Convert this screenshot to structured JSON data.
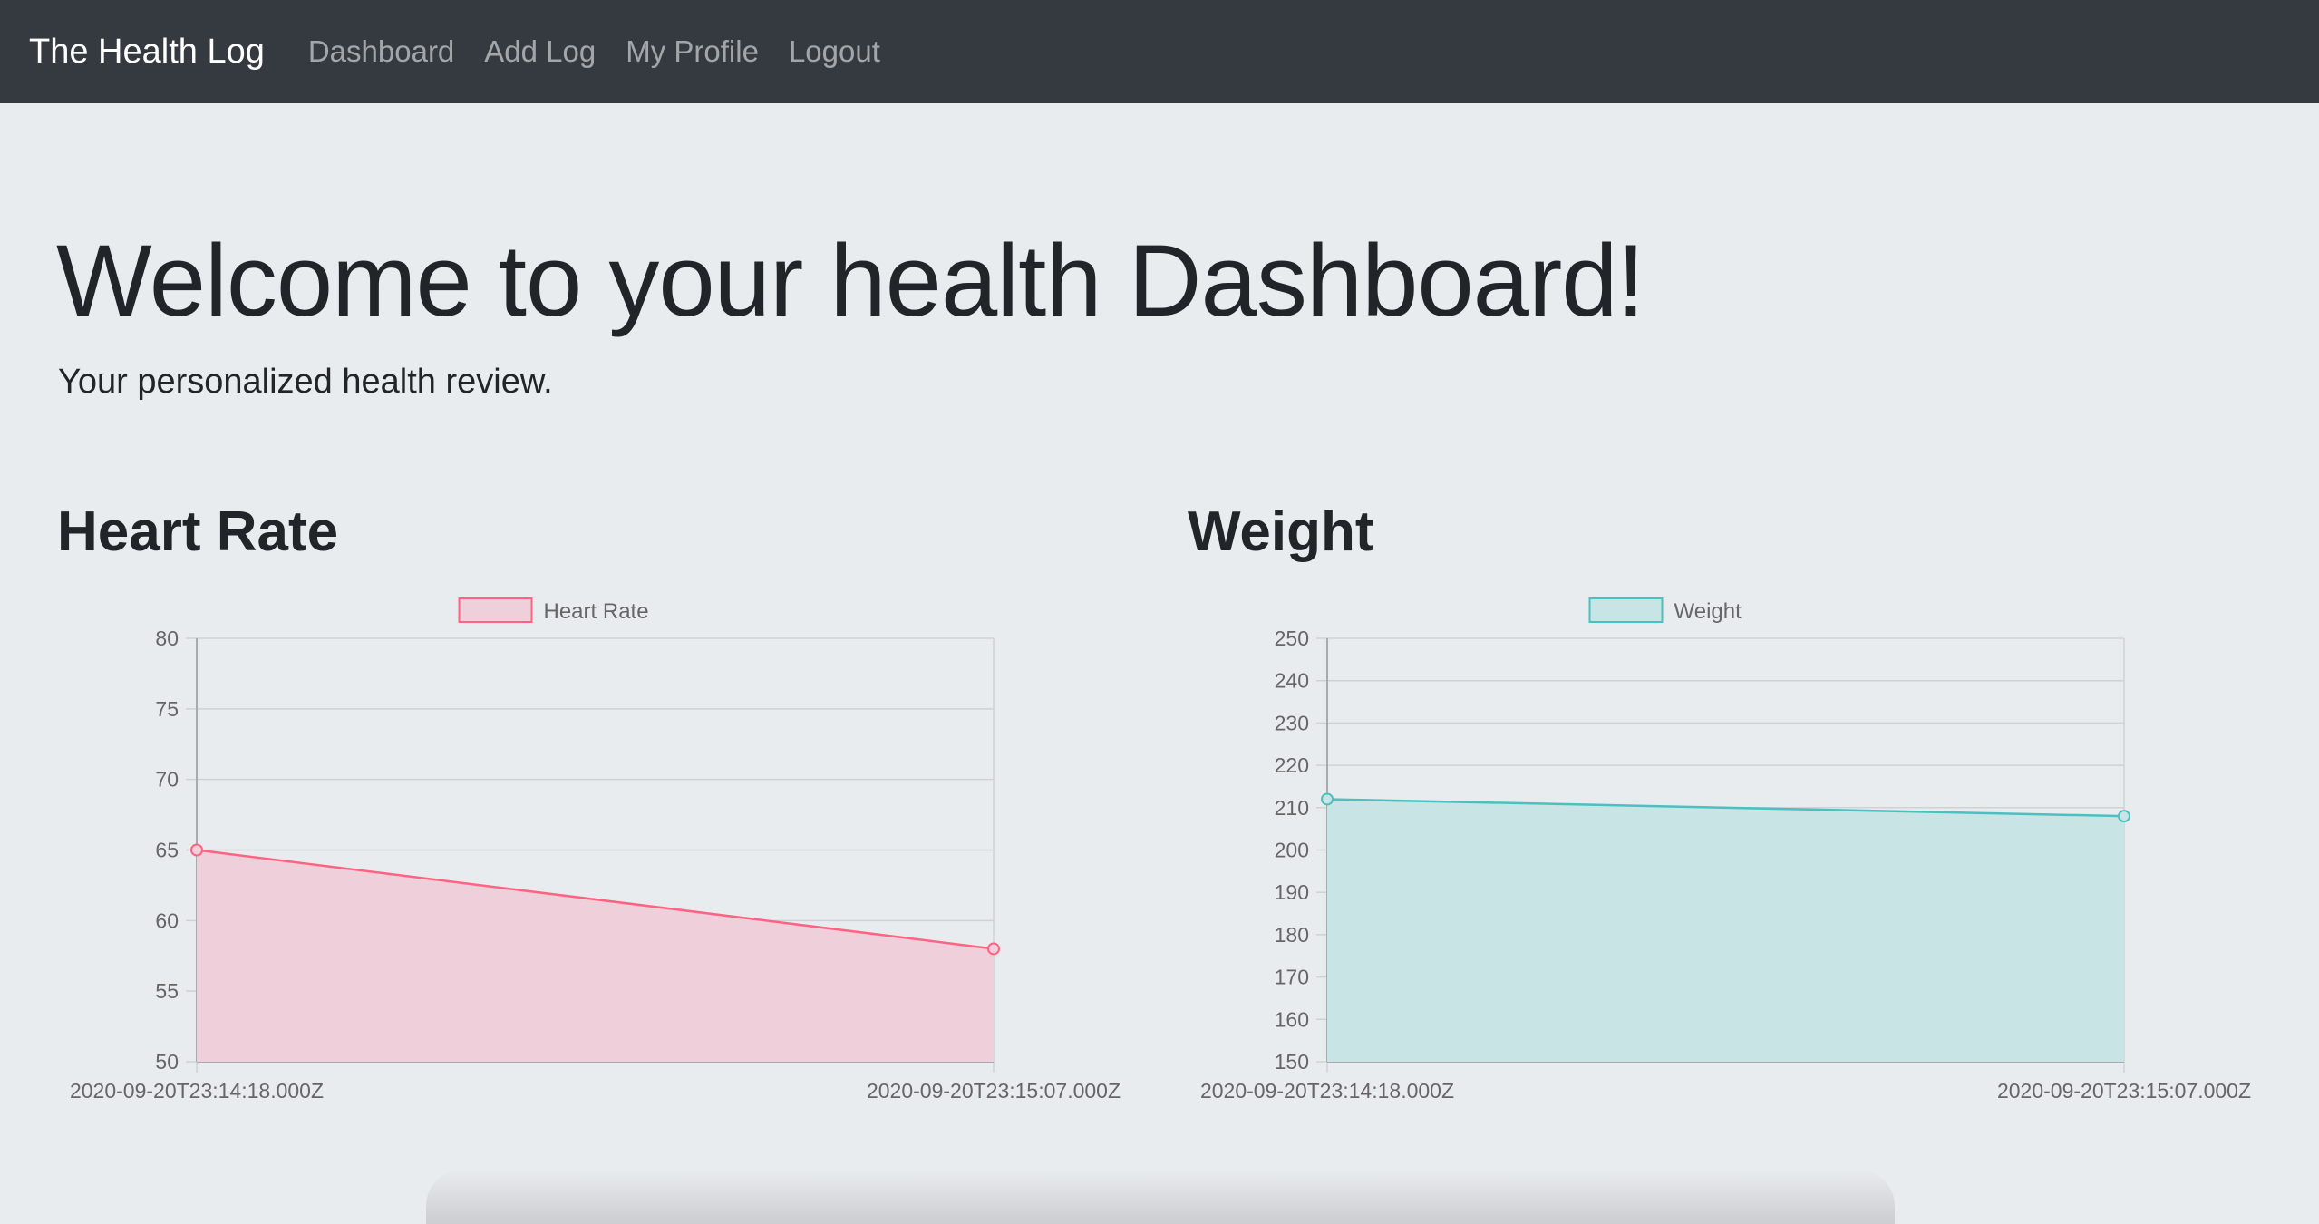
{
  "navbar": {
    "brand": "The Health Log",
    "links": [
      "Dashboard",
      "Add Log",
      "My Profile",
      "Logout"
    ]
  },
  "hero": {
    "title": "Welcome to your health Dashboard!",
    "subtitle": "Your personalized health review."
  },
  "sections": {
    "heart_rate_title": "Heart Rate",
    "weight_title": "Weight"
  },
  "chart_data": [
    {
      "type": "area",
      "title": "Heart Rate",
      "x": [
        "2020-09-20T23:14:18.000Z",
        "2020-09-20T23:15:07.000Z"
      ],
      "series": [
        {
          "name": "Heart Rate",
          "values": [
            65,
            58
          ]
        }
      ],
      "ylim": [
        50,
        80
      ],
      "yticks": [
        50,
        55,
        60,
        65,
        70,
        75,
        80
      ],
      "legend": "top-center",
      "grid": true,
      "line_color": "#ff6384",
      "fill_color": "#efcfd9"
    },
    {
      "type": "area",
      "title": "Weight",
      "x": [
        "2020-09-20T23:14:18.000Z",
        "2020-09-20T23:15:07.000Z"
      ],
      "series": [
        {
          "name": "Weight",
          "values": [
            212,
            208
          ]
        }
      ],
      "ylim": [
        150,
        250
      ],
      "yticks": [
        150,
        160,
        170,
        180,
        190,
        200,
        210,
        220,
        230,
        240,
        250
      ],
      "legend": "top-center",
      "grid": true,
      "line_color": "#4bc0c0",
      "fill_color": "#c9e4e5"
    }
  ]
}
